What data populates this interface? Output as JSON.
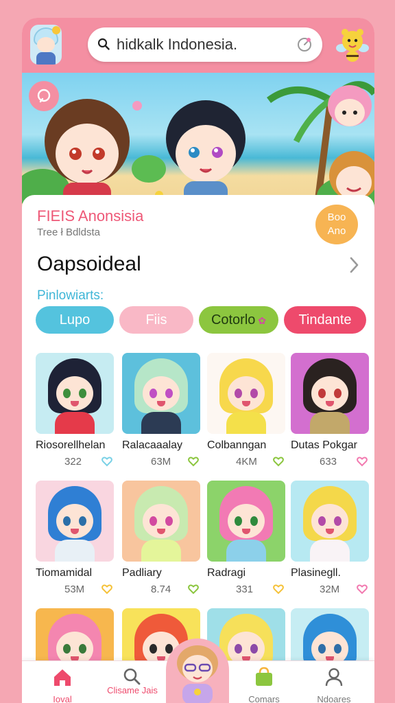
{
  "search": {
    "value": "hidkalk Indonesia."
  },
  "promo": {
    "title": "FIEIS Anonsisia",
    "subtitle": "Tree ł Bdldsta",
    "badge_line1": "Boo",
    "badge_line2": "Ano"
  },
  "section": {
    "title": "Oapsoideal"
  },
  "filters": {
    "label": "Pinlowiarts:",
    "chips": [
      {
        "label": "Lupo",
        "color": "#54c3de"
      },
      {
        "label": "Fiis",
        "color": "#f9b8c6"
      },
      {
        "label": "Cotorlo",
        "color": "#8cc63f"
      },
      {
        "label": "Tindante",
        "color": "#ee4a6c"
      }
    ]
  },
  "items": [
    {
      "name": "Riosorellhelan",
      "count": "322",
      "heart_color": "#7ad1e6",
      "bg": "#c6ecf2",
      "hair": "#1e2236",
      "eye": "#3e8e3c",
      "shirt": "#e53a4a"
    },
    {
      "name": "Ralacaaalay",
      "count": "63M",
      "heart_color": "#8cc63f",
      "bg": "#5dc0dc",
      "hair": "#b6e6c8",
      "eye": "#c04fc4",
      "shirt": "#2c3b54"
    },
    {
      "name": "Colbanngan",
      "count": "4KM",
      "heart_color": "#8cc63f",
      "bg": "#fdf7f2",
      "hair": "#f7d84c",
      "eye": "#b24aa8",
      "shirt": "#f4e04a"
    },
    {
      "name": "Dutas Pokgar",
      "count": "633",
      "heart_color": "#f27ab0",
      "bg": "#d36fcf",
      "hair": "#2a2220",
      "eye": "#c03a3a",
      "shirt": "#c2a86a"
    },
    {
      "name": "Tiomamidal",
      "count": "53M",
      "heart_color": "#f5c23a",
      "bg": "#f9d6e0",
      "hair": "#2f7fd4",
      "eye": "#2b6fa8",
      "shirt": "#e8f0f6"
    },
    {
      "name": "Padliary",
      "count": "8.74",
      "heart_color": "#8cc63f",
      "bg": "#f8c59e",
      "hair": "#c8eab0",
      "eye": "#d24aa0",
      "shirt": "#e4f59a"
    },
    {
      "name": "Radragi",
      "count": "331",
      "heart_color": "#f5c23a",
      "bg": "#8cd36a",
      "hair": "#f27ab4",
      "eye": "#2f8a3c",
      "shirt": "#8cd0ea"
    },
    {
      "name": "Plasinegll.",
      "count": "32M",
      "heart_color": "#f27ab0",
      "bg": "#b7e9f2",
      "hair": "#f4d84a",
      "eye": "#b24aa8",
      "shirt": "#f9f3f6"
    },
    {
      "name": "",
      "count": "",
      "heart_color": "",
      "bg": "#f7b74e",
      "hair": "#f486b0",
      "eye": "#3a7a3a",
      "shirt": "#fff"
    },
    {
      "name": "",
      "count": "",
      "heart_color": "",
      "bg": "#f8e25a",
      "hair": "#ef5a3a",
      "eye": "#2a2a2a",
      "shirt": "#fff"
    },
    {
      "name": "",
      "count": "",
      "heart_color": "",
      "bg": "#9fdfe8",
      "hair": "#f6e05a",
      "eye": "#8c4aa8",
      "shirt": "#fff"
    },
    {
      "name": "",
      "count": "",
      "heart_color": "",
      "bg": "#c6edf3",
      "hair": "#2f8fd8",
      "eye": "#2f6fa8",
      "shirt": "#fff"
    }
  ],
  "nav": [
    {
      "label": "Ioval",
      "icon": "home-icon",
      "active": true
    },
    {
      "label": "Clisame Jais",
      "icon": "search-icon",
      "active": false
    },
    {
      "label": "",
      "icon": "avatar",
      "active": false
    },
    {
      "label": "Comars",
      "icon": "bag-icon",
      "active": false
    },
    {
      "label": "Ndoares",
      "icon": "user-icon",
      "active": false
    }
  ],
  "colors": {
    "topbar": "#f48fa2",
    "accent_pink": "#ee5877",
    "accent_teal": "#3fb6d7"
  }
}
